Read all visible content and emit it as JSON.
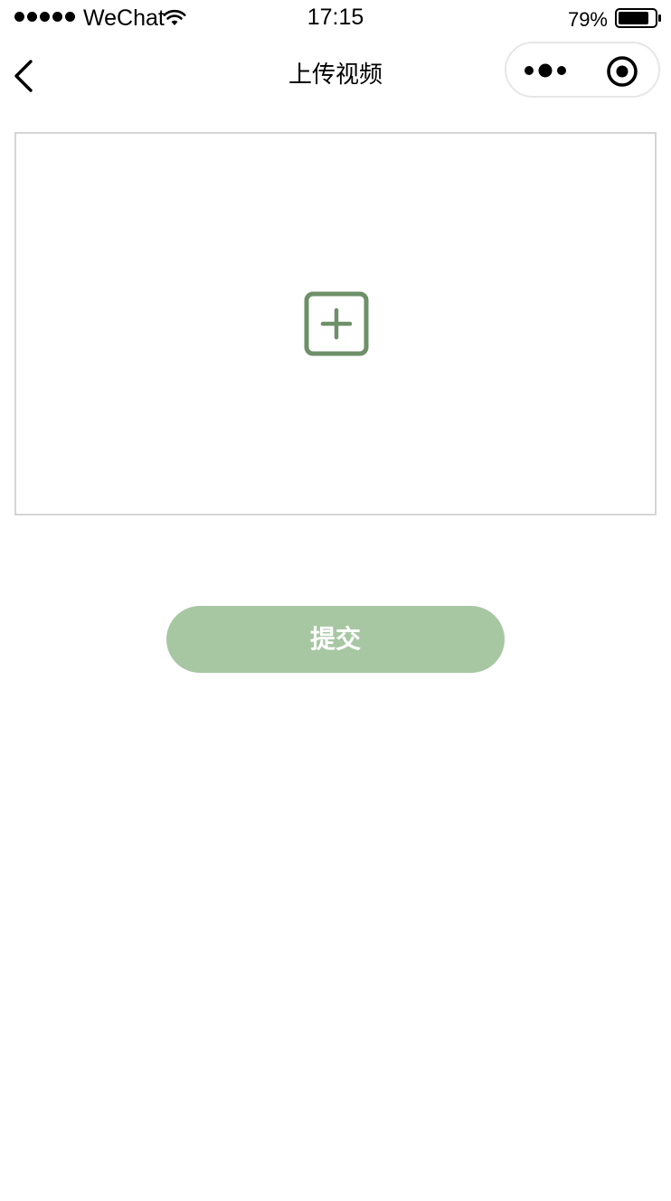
{
  "status_bar": {
    "carrier": "WeChat",
    "time": "17:15",
    "battery_percent": "79%",
    "icons": [
      "signal-dots-icon",
      "wifi-icon",
      "battery-icon"
    ]
  },
  "nav": {
    "back_icon": "chevron-left-icon",
    "title": "上传视频",
    "capsule_icons": [
      "more-icon",
      "target-icon"
    ]
  },
  "upload": {
    "icon": "add-square-icon",
    "accent_color": "#6e9069"
  },
  "actions": {
    "submit_label": "提交",
    "submit_color": "#a7c7a3"
  }
}
